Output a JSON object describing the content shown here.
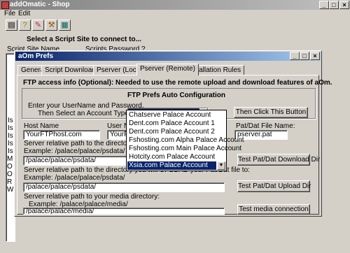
{
  "main_window": {
    "title": "addOmatic - Shop",
    "menu": [
      "File",
      "Edit"
    ],
    "left_panel": {
      "heading": "Select a Script Site to connect to...",
      "col1": "Script Site Name",
      "col2": "Scripts Password ?",
      "list_fragments": [
        "Is",
        "Is",
        "Is",
        "Is",
        "Is",
        "M",
        "O",
        "O",
        "R",
        "W"
      ]
    }
  },
  "prefs_dialog": {
    "title": "aOm Prefs",
    "tabs": [
      "General",
      "Script Downloading",
      "Pserver (Local)",
      "Pserver (Remote)",
      "Installation Rules"
    ],
    "active_tab": 3,
    "ftp_header": "FTP access info (Optional): Needed to use the remote upload and download features of aOm.",
    "auto_config": {
      "title": "FTP Prefs Auto Configuration",
      "instr1": "Enter your UserName and Password,",
      "instr2": "Then Select an Account Type --->",
      "button": "Then Click This Button"
    },
    "host_label": "Host Name",
    "host_value": "YourFTPhost.com",
    "user_label": "User Na",
    "user_value": "YourF",
    "patdat_label": "Pat/Dat File Name:",
    "patdat_value": "pserver.pat",
    "download": {
      "label1": "Server relative path to the directory you will",
      "example": "Example: /palace/palace/psdata/",
      "value": "/palace/palace/psdata/",
      "button": "Test Pat/Dat Download Dir"
    },
    "upload": {
      "label1": "Server relative path to the directory you will UPLOAD your Pat/Dat file to:",
      "example": "Example: /palace/palace/psdata/",
      "value": "/palace/palace/psdata/",
      "button": "Test Pat/Dat Upload Dir"
    },
    "media": {
      "label1": "Server relative path to your media directory:",
      "example": "Example: /palace/palace/media/",
      "value": "/palace/palace/media/",
      "button": "Test media connection"
    },
    "dropdown_items": [
      "Chatserve Palace Account",
      "Dent.com Palace Account 1",
      "Dent.com Palace Account 2",
      "Fshosting.com Alpha Palace Account",
      "Fshosting.com Main Palace Account",
      "Hotcity.com Palace Account",
      "Xsia.com Palace Account"
    ],
    "dropdown_selected": 6
  }
}
